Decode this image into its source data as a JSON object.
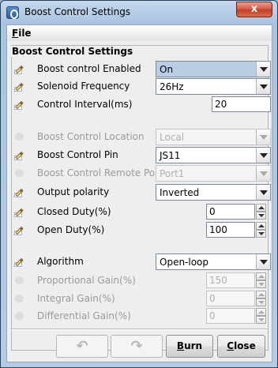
{
  "window": {
    "title": "Boost Control Settings",
    "close_glyph": "x"
  },
  "menu": {
    "file_mnemonic": "F",
    "file_rest": "ile"
  },
  "group_title": "Boost Control Settings",
  "rows": [
    {
      "label": "Boost control Enabled",
      "value": "On",
      "control": "combo",
      "enabled": true
    },
    {
      "label": "Solenoid Frequency",
      "value": "26Hz",
      "control": "combo",
      "enabled": true
    },
    {
      "label": "Control Interval(ms)",
      "value": "20",
      "control": "text",
      "enabled": true
    },
    {
      "label": "Boost Control Location",
      "value": "Local",
      "control": "combo",
      "enabled": false
    },
    {
      "label": "Boost Control Pin",
      "value": "JS11",
      "control": "combo",
      "enabled": true
    },
    {
      "label": "Boost Control Remote Port",
      "value": "Port1",
      "control": "combo",
      "enabled": false
    },
    {
      "label": "Output polarity",
      "value": "Inverted",
      "control": "combo",
      "enabled": true
    },
    {
      "label": "Closed Duty(%)",
      "value": "0",
      "control": "spinner",
      "enabled": true
    },
    {
      "label": "Open Duty(%)",
      "value": "100",
      "control": "spinner",
      "enabled": true
    },
    {
      "label": "Algorithm",
      "value": "Open-loop",
      "control": "combo",
      "enabled": true
    },
    {
      "label": "Proportional Gain(%)",
      "value": "150",
      "control": "spinner",
      "enabled": false
    },
    {
      "label": "Integral Gain(%)",
      "value": "0",
      "control": "spinner",
      "enabled": false
    },
    {
      "label": "Differential Gain(%)",
      "value": "0",
      "control": "spinner",
      "enabled": false
    }
  ],
  "buttons": {
    "undo_icon": "↶",
    "redo_icon": "↷",
    "burn_mnemonic": "B",
    "burn_rest": "urn",
    "close_mnemonic": "C",
    "close_rest": "lose"
  }
}
